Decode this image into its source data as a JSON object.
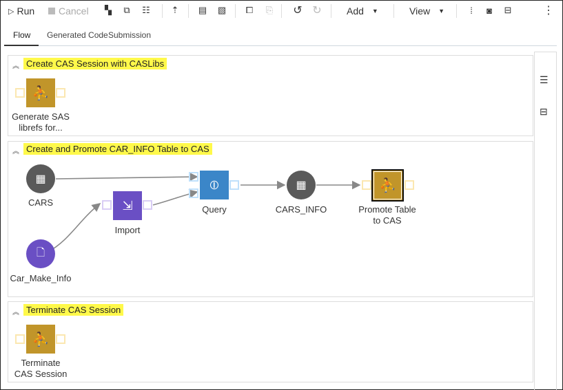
{
  "toolbar": {
    "run": "Run",
    "cancel": "Cancel",
    "add": "Add",
    "view": "View"
  },
  "tabs": [
    "Flow",
    "Generated Code",
    "Submission"
  ],
  "swimlanes": [
    {
      "title": "Create CAS Session with CASLibs",
      "nodes": {
        "generate": "Generate SAS",
        "generate2": "librefs for..."
      }
    },
    {
      "title": "Create and Promote CAR_INFO Table to CAS",
      "nodes": {
        "cars": "CARS",
        "car_make": "Car_Make_Info",
        "import": "Import",
        "query": "Query",
        "cars_info": "CARS_INFO",
        "promote1": "Promote Table",
        "promote2": "to CAS"
      }
    },
    {
      "title": "Terminate CAS Session",
      "nodes": {
        "term1": "Terminate",
        "term2": "CAS Session"
      }
    }
  ],
  "colors": {
    "highlight": "#fff94a",
    "sas_program": "#c1952a",
    "table": "#5a5a5a",
    "import": "#6a4fc4",
    "query": "#3b86c8"
  }
}
